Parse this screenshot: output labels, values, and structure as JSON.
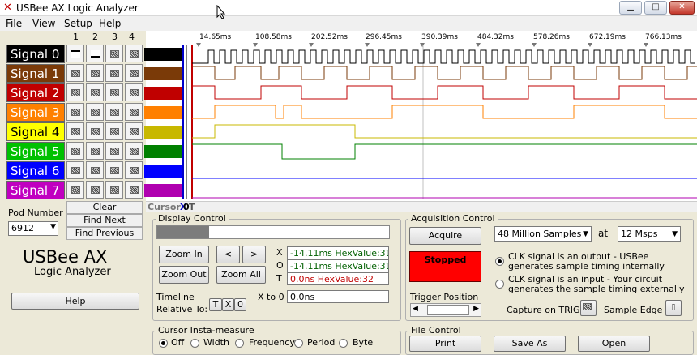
{
  "window": {
    "title": "USBee AX Logic Analyzer",
    "app_icon": "crossed-tools-icon"
  },
  "menu": [
    "File",
    "View",
    "Setup",
    "Help"
  ],
  "trigger_columns": [
    "1",
    "2",
    "3",
    "4"
  ],
  "signals": [
    {
      "label": "Signal 0",
      "bg": "#000000",
      "fg": "#ffffff",
      "swatch": "#000000"
    },
    {
      "label": "Signal 1",
      "bg": "#7a3a08",
      "fg": "#ffffff",
      "swatch": "#7a3a08"
    },
    {
      "label": "Signal 2",
      "bg": "#c00000",
      "fg": "#ffffff",
      "swatch": "#c00000"
    },
    {
      "label": "Signal 3",
      "bg": "#ff8000",
      "fg": "#ffffff",
      "swatch": "#ff8000"
    },
    {
      "label": "Signal 4",
      "bg": "#ffff00",
      "fg": "#000000",
      "swatch": "#c8b800"
    },
    {
      "label": "Signal 5",
      "bg": "#00c000",
      "fg": "#ffffff",
      "swatch": "#008000"
    },
    {
      "label": "Signal 6",
      "bg": "#0000ff",
      "fg": "#ffffff",
      "swatch": "#0000ff"
    },
    {
      "label": "Signal 7",
      "bg": "#c000c0",
      "fg": "#ffffff",
      "swatch": "#b000b0"
    }
  ],
  "search_buttons": {
    "clear": "Clear",
    "find_next": "Find Next",
    "find_previous": "Find Previous"
  },
  "pod": {
    "label": "Pod Number",
    "value": "6912"
  },
  "brand": {
    "name": "USBee AX",
    "subtitle": "Logic Analyzer"
  },
  "help_button": "Help",
  "timeline": {
    "ticks": [
      "14.65ms",
      "108.58ms",
      "202.52ms",
      "296.45ms",
      "390.39ms",
      "484.32ms",
      "578.26ms",
      "672.19ms",
      "766.13ms"
    ]
  },
  "cursor_bar": {
    "label": "Cursor",
    "x_marker": "X",
    "zero_marker": "0",
    "t_marker": "T"
  },
  "display_control": {
    "title": "Display Control",
    "zoom_in": "Zoom In",
    "zoom_out": "Zoom Out",
    "zoom_all": "Zoom All",
    "left": "<",
    "right": ">",
    "x_label": "X",
    "o_label": "O",
    "t_label": "T",
    "x_value": "-14.11ms HexValue:31",
    "o_value": "-14.11ms HexValue:31",
    "t_value": "0.0ns HexValue:32",
    "timeline_label": "Timeline",
    "relative_label": "Relative To:",
    "rel_t": "T",
    "rel_x": "X",
    "rel_o": "0",
    "x_to_o_label": "X to 0",
    "x_to_o_value": "0.0ns"
  },
  "cursor_measure": {
    "title": "Cursor Insta-measure",
    "options": [
      "Off",
      "Width",
      "Frequency",
      "Period",
      "Byte"
    ],
    "selected": "Off"
  },
  "acquisition": {
    "title": "Acquisition Control",
    "acquire": "Acquire",
    "samples": "48 Million Samples",
    "at": "at",
    "rate": "12 Msps",
    "status": "Stopped",
    "status_color": "#ff0000",
    "clk_output": "CLK signal is an output - USBee generates sample timing internally",
    "clk_input": "CLK signal is an input - Your circuit generates the sample timing externally",
    "trigger_position": "Trigger Position",
    "trigger_position_percent": 10,
    "capture_on_trig": "Capture on TRIG",
    "sample_edge": "Sample Edge"
  },
  "file_control": {
    "title": "File Control",
    "print": "Print",
    "save_as": "Save As",
    "open": "Open"
  }
}
